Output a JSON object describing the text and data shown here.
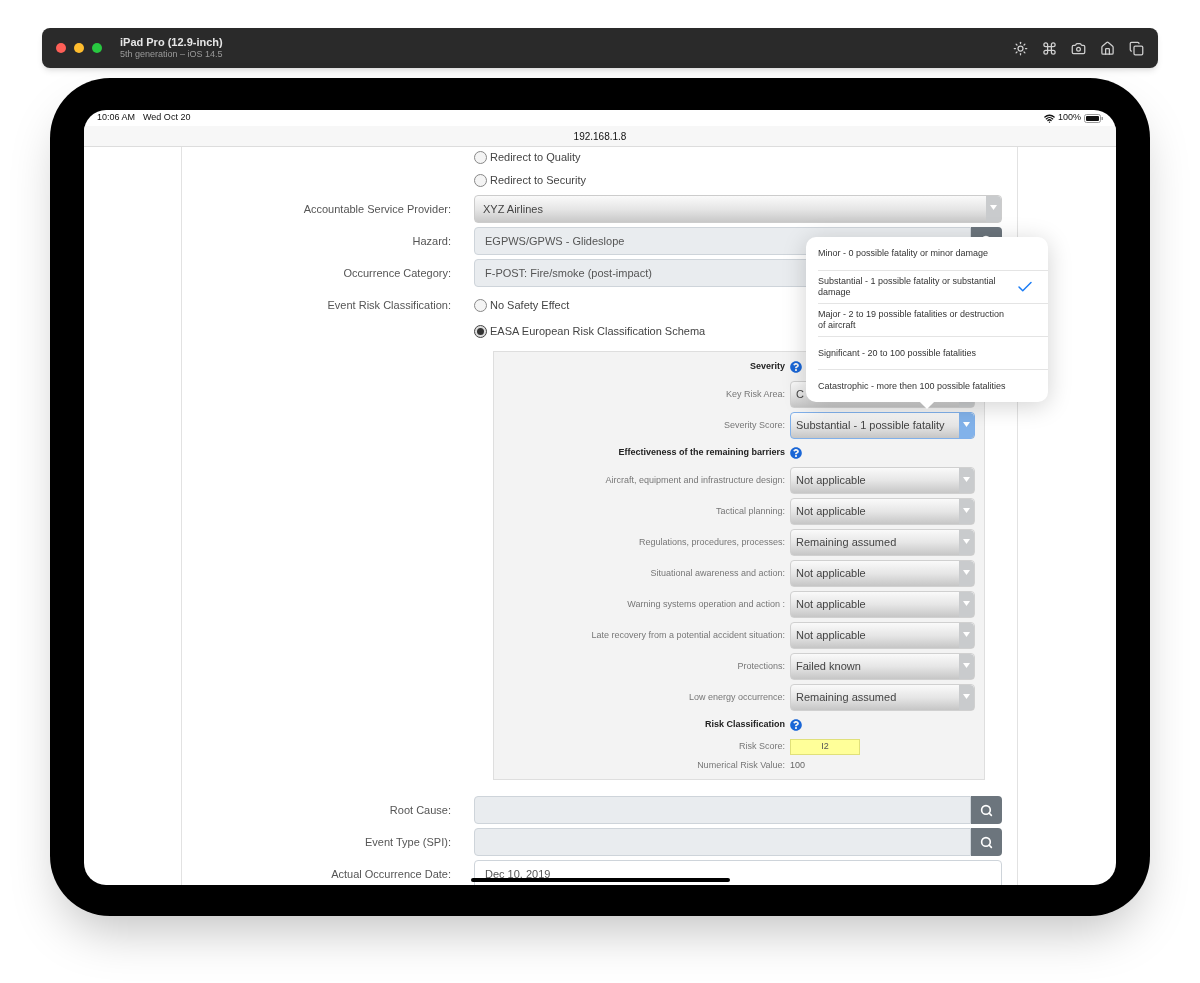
{
  "simulator": {
    "title": "iPad Pro (12.9-inch)",
    "subtitle": "5th generation – iOS 14.5"
  },
  "status_bar": {
    "time": "10:06 AM",
    "date": "Wed Oct 20",
    "battery": "100%"
  },
  "address": "192.168.1.8",
  "routing_options": [
    {
      "label": "Redirect to Quality",
      "selected": false
    },
    {
      "label": "Redirect to Security",
      "selected": false
    }
  ],
  "fields": [
    {
      "label": "Accountable Service Provider:",
      "value": "XYZ Airlines",
      "kind": "select"
    },
    {
      "label": "Hazard:",
      "value": "EGPWS/GPWS - Glideslope",
      "kind": "search"
    },
    {
      "label": "Occurrence Category:",
      "value": "F-POST: Fire/smoke (post-impact)",
      "kind": "readonly"
    }
  ],
  "event_risk": {
    "label": "Event Risk Classification:",
    "options": [
      {
        "label": "No Safety Effect",
        "selected": false
      },
      {
        "label": "EASA European Risk Classification Schema",
        "selected": true
      }
    ]
  },
  "panel": {
    "rows": [
      {
        "kind": "heading",
        "label": "Severity",
        "help": true
      },
      {
        "kind": "select",
        "label": "Key Risk Area:",
        "value": "C",
        "focused": false
      },
      {
        "kind": "select",
        "label": "Severity Score:",
        "value": "Substantial - 1 possible fatality",
        "focused": true
      },
      {
        "kind": "heading",
        "label": "Effectiveness of the remaining barriers",
        "help": true
      },
      {
        "kind": "select",
        "label": "Aircraft, equipment and infrastructure design:",
        "value": "Not applicable",
        "focused": false
      },
      {
        "kind": "select",
        "label": "Tactical planning:",
        "value": "Not applicable",
        "focused": false
      },
      {
        "kind": "select",
        "label": "Regulations, procedures, processes:",
        "value": "Remaining assumed",
        "focused": false
      },
      {
        "kind": "select",
        "label": "Situational awareness and action:",
        "value": "Not applicable",
        "focused": false
      },
      {
        "kind": "select",
        "label": "Warning systems operation and action :",
        "value": "Not applicable",
        "focused": false
      },
      {
        "kind": "select",
        "label": "Late recovery from a potential accident situation:",
        "value": "Not applicable",
        "focused": false
      },
      {
        "kind": "select",
        "label": "Protections:",
        "value": "Failed known",
        "focused": false
      },
      {
        "kind": "select",
        "label": "Low energy occurrence:",
        "value": "Remaining assumed",
        "focused": false
      },
      {
        "kind": "heading",
        "label": "Risk Classification",
        "help": true
      },
      {
        "kind": "score",
        "label": "Risk Score:",
        "value": "I2"
      },
      {
        "kind": "value",
        "label": "Numerical Risk Value:",
        "value": "100"
      }
    ]
  },
  "lower_fields": [
    {
      "label": "Root Cause:",
      "kind": "search"
    },
    {
      "label": "Event Type (SPI):",
      "kind": "search"
    },
    {
      "label": "Actual Occurrence Date:",
      "value": "Dec 10, 2019",
      "kind": "text"
    }
  ],
  "severity_menu": [
    {
      "label": "Minor - 0 possible fatality or minor damage",
      "selected": false
    },
    {
      "label": "Substantial - 1 possible fatality or substantial damage",
      "selected": true
    },
    {
      "label": "Major - 2 to 19 possible fatalities or destruction of aircraft",
      "selected": false
    },
    {
      "label": "Significant - 20 to 100 possible fatalities",
      "selected": false
    },
    {
      "label": "Catastrophic - more then 100 possible fatalities",
      "selected": false
    }
  ]
}
